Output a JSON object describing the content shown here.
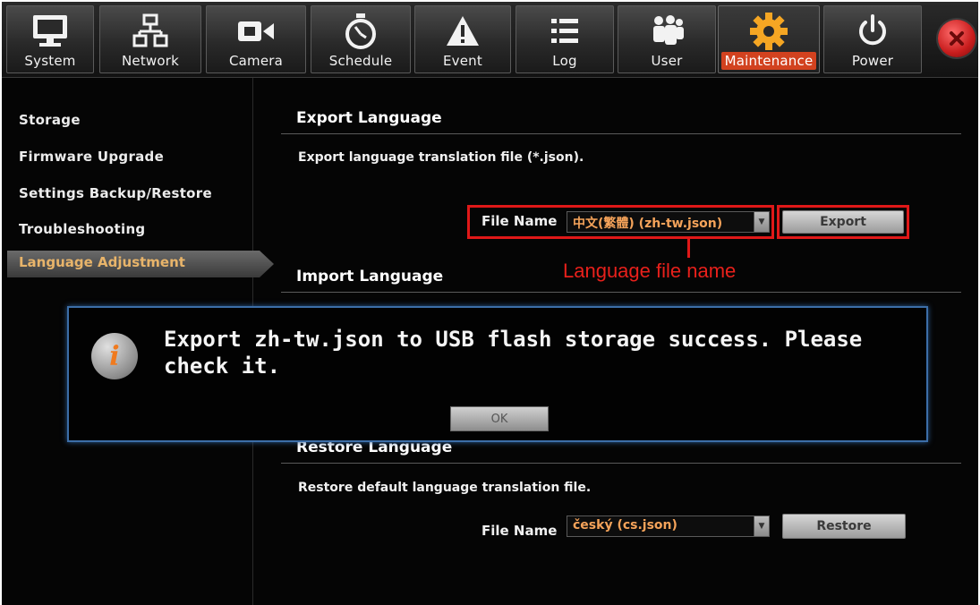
{
  "toolbar": {
    "tabs": [
      {
        "label": "System",
        "icon": "monitor-icon"
      },
      {
        "label": "Network",
        "icon": "network-icon"
      },
      {
        "label": "Camera",
        "icon": "camera-icon"
      },
      {
        "label": "Schedule",
        "icon": "stopwatch-icon"
      },
      {
        "label": "Event",
        "icon": "warning-icon"
      },
      {
        "label": "Log",
        "icon": "list-icon"
      },
      {
        "label": "User",
        "icon": "users-icon"
      },
      {
        "label": "Maintenance",
        "icon": "gear-icon",
        "active": true
      },
      {
        "label": "Power",
        "icon": "power-icon"
      }
    ],
    "accent": "#f5a623",
    "close_color": "#d92b2b"
  },
  "sidebar": {
    "items": [
      {
        "label": "Storage"
      },
      {
        "label": "Firmware Upgrade"
      },
      {
        "label": "Settings Backup/Restore"
      },
      {
        "label": "Troubleshooting"
      },
      {
        "label": "Language Adjustment",
        "active": true
      }
    ]
  },
  "export": {
    "title": "Export Language",
    "description": "Export language translation file (*.json).",
    "file_label": "File Name",
    "file_value": "中文(繁體) (zh-tw.json)",
    "button": "Export",
    "annotation": "Language file name"
  },
  "import": {
    "title": "Import Language"
  },
  "restore": {
    "title": "Restore Language",
    "description": "Restore default language translation file.",
    "file_label": "File Name",
    "file_value": "český (cs.json)",
    "button": "Restore"
  },
  "dialog": {
    "icon": "info-icon",
    "message": "Export zh-tw.json to USB flash storage success. Please check it.",
    "ok_label": "OK"
  },
  "colors": {
    "highlight": "#e01818",
    "value_text": "#f5a35a",
    "dialog_border": "#3c6ea8"
  }
}
